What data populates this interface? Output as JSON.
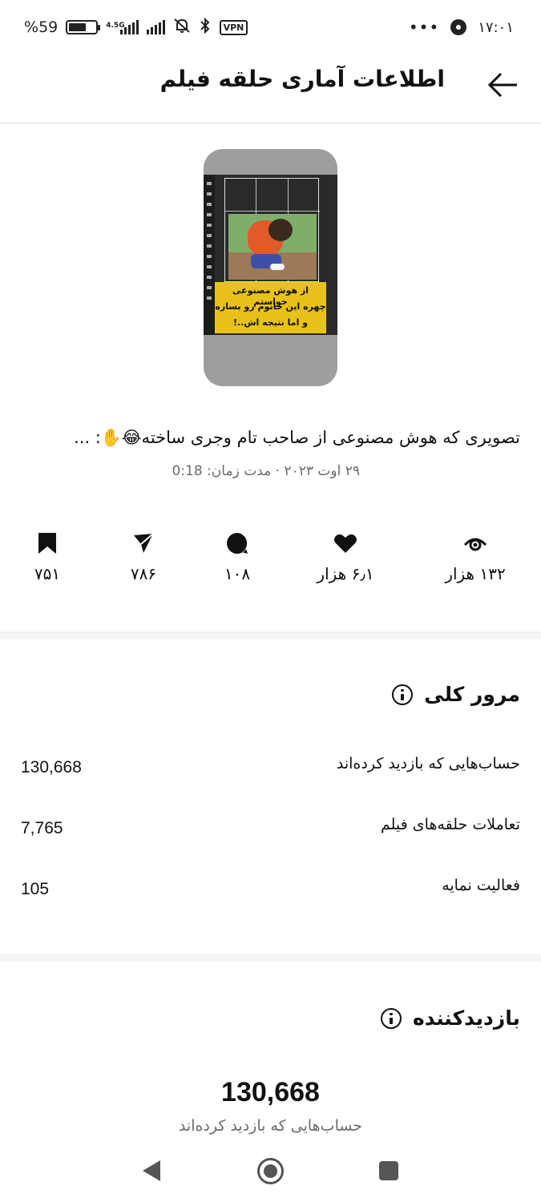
{
  "status_bar": {
    "battery_percent": "59",
    "percent_sign": "%",
    "network": "4.5G",
    "vpn": "VPN",
    "time": "۱۷:۰۱",
    "dots": "•••"
  },
  "header": {
    "title": "اطلاعات آماری حلقه فیلم"
  },
  "thumbnail": {
    "caption_lines": [
      "از هوش مصنوعی خواستم",
      "چهره این خانوم رو بسازه",
      "و اما نتیجه اش..!"
    ]
  },
  "post": {
    "description": "تصویری که هوش مصنوعی از صاحب تام وجری ساخته😂✋: ...",
    "date": "۲۹ اوت ۲۰۲۳",
    "separator": "·",
    "duration_label": "مدت زمان:",
    "duration": "0:18"
  },
  "stats": {
    "views": "۱۳۲ هزار",
    "likes": "۶٫۱ هزار",
    "comments": "۱۰۸",
    "shares": "۷۸۶",
    "saves": "۷۵۱"
  },
  "overview": {
    "title": "مرور کلی",
    "rows": [
      {
        "label": "حساب‌هایی که بازدید کرده‌اند",
        "value": "130,668"
      },
      {
        "label": "تعاملات حلقه‌های فیلم",
        "value": "7,765"
      },
      {
        "label": "فعالیت نمایه",
        "value": "105"
      }
    ]
  },
  "viewers": {
    "title": "بازدیدکننده",
    "total": "130,668",
    "total_label": "حساب‌هایی که بازدید کرده‌اند"
  },
  "icons": {
    "back": "arrow-left-icon",
    "views": "eye-icon",
    "likes": "heart-icon",
    "comments": "comment-icon",
    "shares": "send-icon",
    "saves": "bookmark-icon",
    "info": "info-icon"
  }
}
